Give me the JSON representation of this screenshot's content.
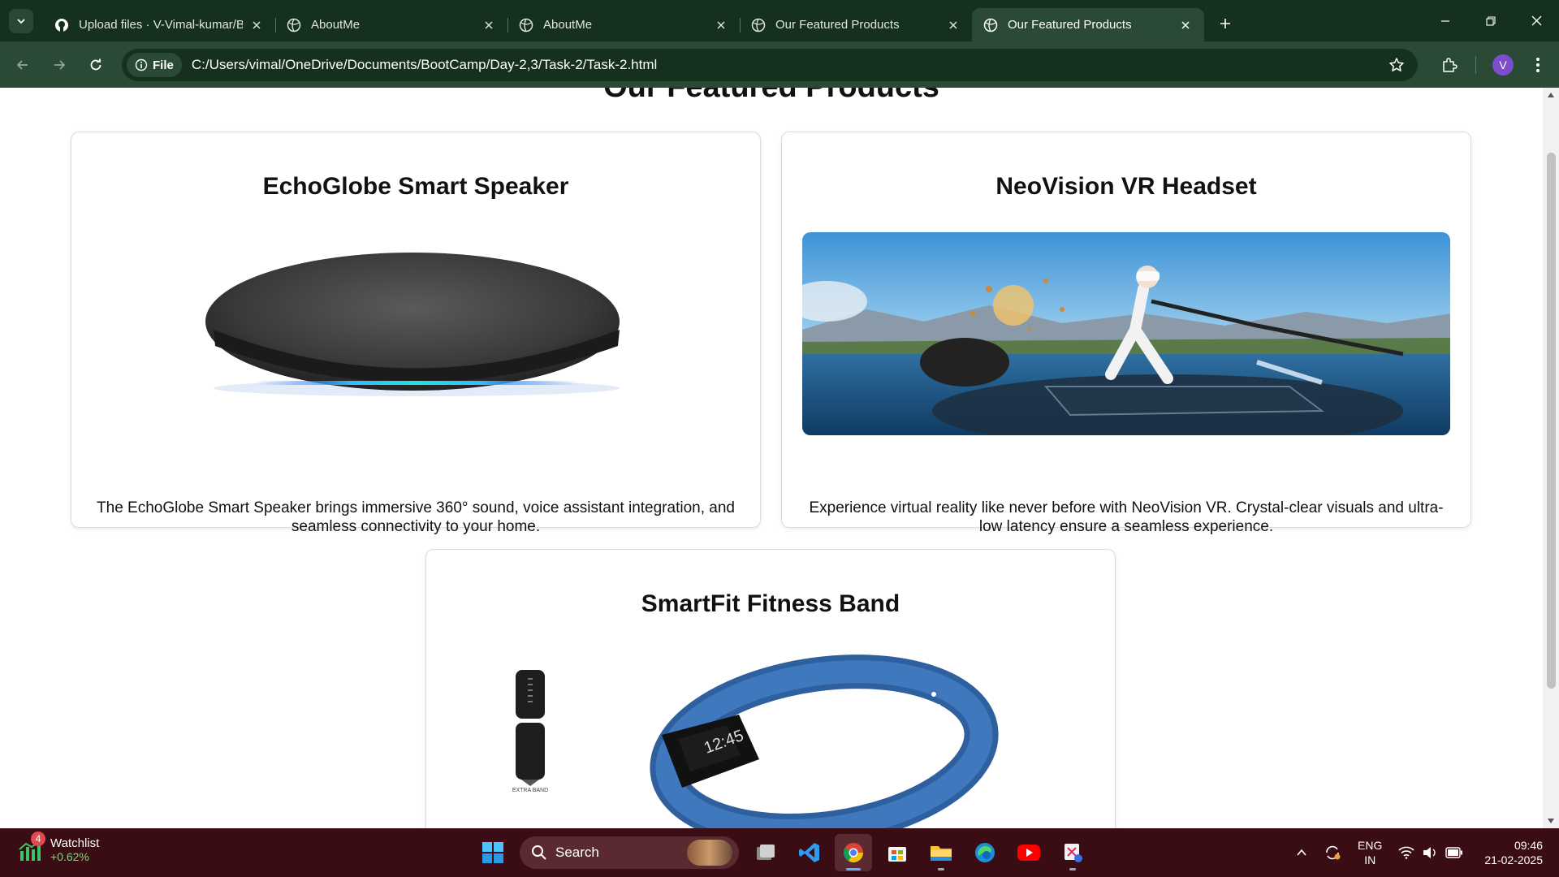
{
  "browser": {
    "tabs": [
      {
        "title": "Upload files · V-Vimal-kumar/B",
        "icon": "github-icon",
        "active": false
      },
      {
        "title": "AboutMe",
        "icon": "globe-icon",
        "active": false
      },
      {
        "title": "AboutMe",
        "icon": "globe-icon",
        "active": false
      },
      {
        "title": "Our Featured Products",
        "icon": "globe-icon",
        "active": false
      },
      {
        "title": "Our Featured Products",
        "icon": "globe-icon",
        "active": true
      }
    ],
    "site_chip": "File",
    "url": "C:/Users/vimal/OneDrive/Documents/BootCamp/Day-2,3/Task-2/Task-2.html",
    "profile_initial": "V",
    "accent": "#2b4a35"
  },
  "page": {
    "title": "Our Featured Products",
    "products": [
      {
        "name": "EchoGlobe Smart Speaker",
        "description": "The EchoGlobe Smart Speaker brings immersive 360° sound, voice assistant integration, and seamless connectivity to your home."
      },
      {
        "name": "NeoVision VR Headset",
        "description": "Experience virtual reality like never before with NeoVision VR. Crystal-clear visuals and ultra-low latency ensure a seamless experience."
      },
      {
        "name": "SmartFit Fitness Band",
        "description": ""
      }
    ],
    "band_label": "EXTRA BAND",
    "band_time": "12:45"
  },
  "taskbar": {
    "widget_title": "Watchlist",
    "widget_change": "+0.62%",
    "widget_badge": "4",
    "search_placeholder": "Search",
    "lang_top": "ENG",
    "lang_bottom": "IN",
    "time": "09:46",
    "date": "21-02-2025"
  }
}
